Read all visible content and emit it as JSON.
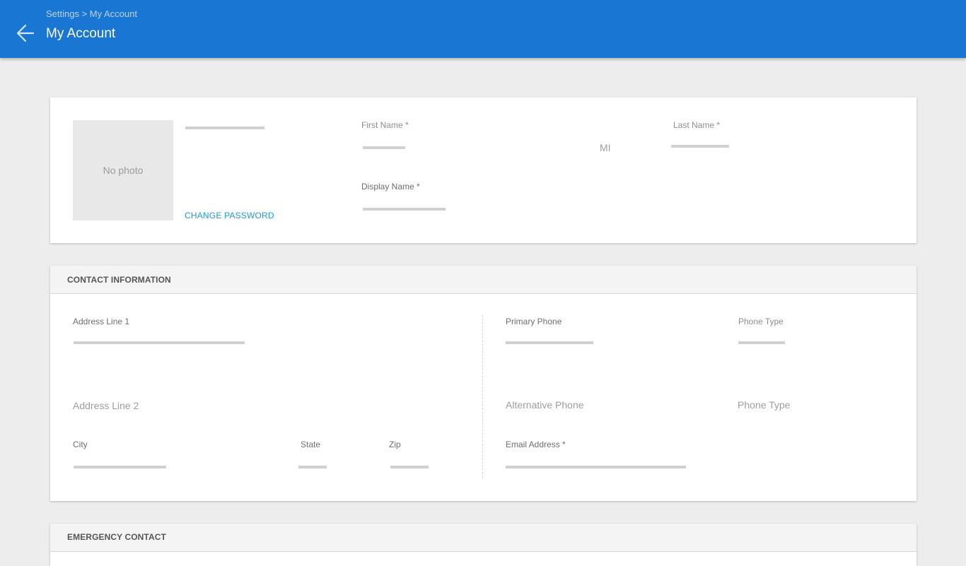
{
  "header": {
    "breadcrumb": "Settings > My Account",
    "title": "My Account",
    "back_icon": "arrow-left-icon"
  },
  "profile": {
    "photo_placeholder": "No photo",
    "change_password": "CHANGE PASSWORD",
    "first_name_label": "First Name *",
    "mi_label": "MI",
    "last_name_label": "Last Name *",
    "display_name_label": "Display Name *"
  },
  "contact": {
    "section_title": "CONTACT INFORMATION",
    "address1_label": "Address Line 1",
    "address2_placeholder": "Address Line 2",
    "city_label": "City",
    "state_label": "State",
    "zip_label": "Zip",
    "primary_phone_label": "Primary Phone",
    "phone_type_label": "Phone Type",
    "alt_phone_placeholder": "Alternative Phone",
    "alt_phone_type_placeholder": "Phone Type",
    "email_label": "Email Address *"
  },
  "emergency": {
    "section_title": "EMERGENCY CONTACT"
  },
  "colors": {
    "accent": "#1976d2",
    "link": "#1a9ad6",
    "background": "#ededed"
  }
}
